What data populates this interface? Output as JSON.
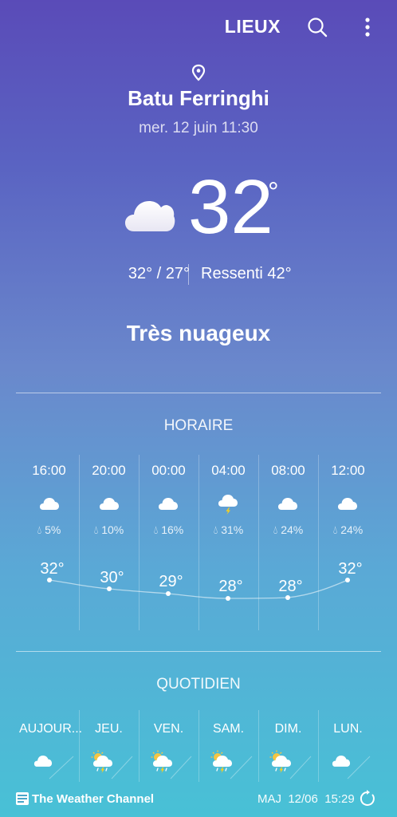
{
  "topbar": {
    "title": "LIEUX"
  },
  "location": {
    "city": "Batu Ferringhi",
    "datetime": "mer. 12 juin 11:30"
  },
  "current": {
    "temp": "32",
    "deg": "°",
    "hilo": "32° / 27°",
    "feels": "Ressenti 42°",
    "condition": "Très nuageux",
    "icon": "cloud-icon"
  },
  "hourly": {
    "title": "HORAIRE",
    "items": [
      {
        "time": "16:00",
        "precip": "5%",
        "temp": "32°",
        "icon": "cloud-icon"
      },
      {
        "time": "20:00",
        "precip": "10%",
        "temp": "30°",
        "icon": "cloud-icon"
      },
      {
        "time": "00:00",
        "precip": "16%",
        "temp": "29°",
        "icon": "cloud-icon"
      },
      {
        "time": "04:00",
        "precip": "31%",
        "temp": "28°",
        "icon": "thunder-cloud-icon"
      },
      {
        "time": "08:00",
        "precip": "24%",
        "temp": "28°",
        "icon": "cloud-icon"
      },
      {
        "time": "12:00",
        "precip": "24%",
        "temp": "32°",
        "icon": "cloud-icon"
      }
    ]
  },
  "daily": {
    "title": "QUOTIDIEN",
    "items": [
      {
        "day": "AUJOUR...",
        "icon": "cloud-icon"
      },
      {
        "day": "JEU.",
        "icon": "sun-thunder-rain-icon"
      },
      {
        "day": "VEN.",
        "icon": "sun-thunder-rain-icon"
      },
      {
        "day": "SAM.",
        "icon": "sun-thunder-rain-icon"
      },
      {
        "day": "DIM.",
        "icon": "sun-thunder-rain-icon"
      },
      {
        "day": "LUN.",
        "icon": "cloud-icon"
      }
    ]
  },
  "footer": {
    "provider": "The Weather Channel",
    "updated": "MAJ  12/06  15:29"
  },
  "colors": {
    "accent_sun": "#f5c542",
    "bolt": "#f5d020"
  }
}
